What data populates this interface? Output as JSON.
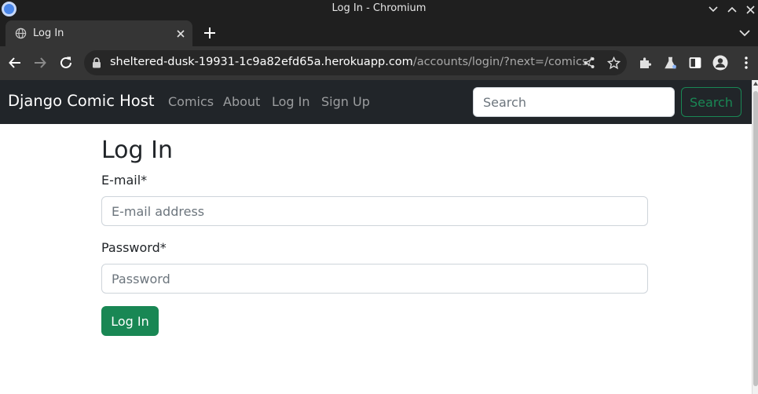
{
  "window": {
    "title": "Log In - Chromium"
  },
  "browser": {
    "tabs": [
      {
        "label": "Log In",
        "icon": "globe-icon"
      }
    ],
    "url_host": "sheltered-dusk-19931-1c9a82efd65a.herokuapp.com",
    "url_path": "/accounts/login/?next=/comics/"
  },
  "site": {
    "brand": "Django Comic Host",
    "nav": [
      "Comics",
      "About",
      "Log In",
      "Sign Up"
    ],
    "search_placeholder": "Search",
    "search_button": "Search"
  },
  "form": {
    "title": "Log In",
    "email_label": "E-mail*",
    "email_placeholder": "E-mail address",
    "password_label": "Password*",
    "password_placeholder": "Password",
    "submit_label": "Log In"
  },
  "colors": {
    "navbar": "#212529",
    "success": "#198754"
  }
}
